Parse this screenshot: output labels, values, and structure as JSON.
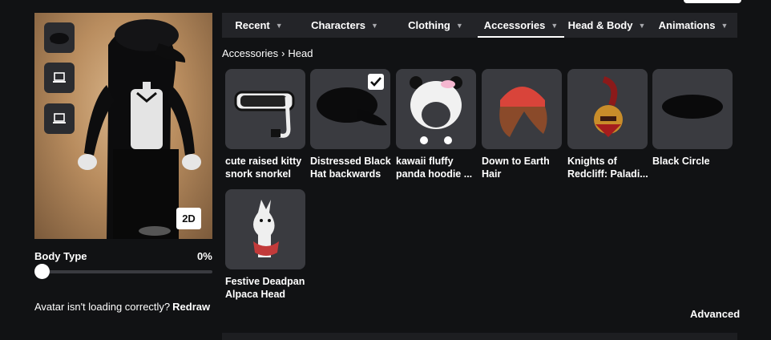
{
  "preview": {
    "toggle_2d_label": "2D",
    "thumbnails": [
      "hat-thumbnail",
      "computer-icon",
      "computer-icon"
    ]
  },
  "body_type": {
    "label": "Body Type",
    "value": "0%",
    "level": 0
  },
  "warning": {
    "text": "Avatar isn't loading correctly?",
    "action": "Redraw"
  },
  "tabs": [
    {
      "label": "Recent",
      "active": false
    },
    {
      "label": "Characters",
      "active": false
    },
    {
      "label": "Clothing",
      "active": false
    },
    {
      "label": "Accessories",
      "active": true
    },
    {
      "label": "Head & Body",
      "active": false
    },
    {
      "label": "Animations",
      "active": false
    }
  ],
  "breadcrumb": {
    "parent": "Accessories",
    "current": "Head"
  },
  "items": [
    {
      "name": "cute raised kitty snork snorkel in...",
      "selected": false,
      "icon": "snorkel-goggles"
    },
    {
      "name": "Distressed Black Hat backwards",
      "selected": true,
      "icon": "black-cap"
    },
    {
      "name": "kawaii fluffy panda hoodie ...",
      "selected": false,
      "icon": "panda-hoodie"
    },
    {
      "name": "Down to Earth Hair",
      "selected": false,
      "icon": "red-beanie-hair"
    },
    {
      "name": "Knights of Redcliff: Paladi...",
      "selected": false,
      "icon": "knight-helmet"
    },
    {
      "name": "Black Circle",
      "selected": false,
      "icon": "black-circle"
    },
    {
      "name": "Festive Deadpan Alpaca Head",
      "selected": false,
      "icon": "alpaca-head"
    }
  ],
  "advanced_label": "Advanced"
}
